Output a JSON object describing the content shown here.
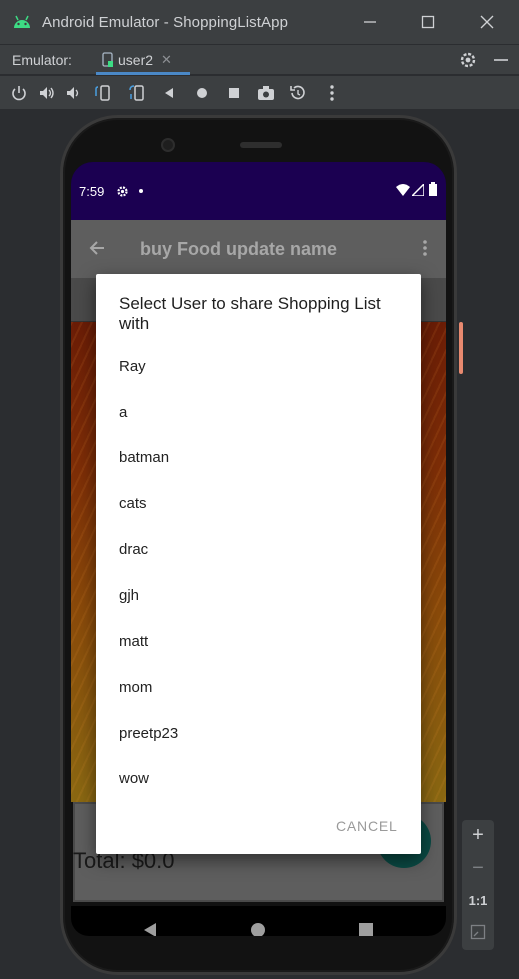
{
  "window": {
    "title": "Android Emulator - ShoppingListApp",
    "minimize_icon": "minimize-icon",
    "maximize_icon": "maximize-icon",
    "close_icon": "close-icon"
  },
  "tabbar": {
    "label": "Emulator:",
    "device_tab": "user2",
    "close_glyph": "✕"
  },
  "toolbar": {
    "icons": [
      "power-icon",
      "volume-up-icon",
      "volume-down-icon",
      "rotate-left-icon",
      "rotate-right-icon",
      "back-icon",
      "home-icon",
      "overview-icon",
      "screenshot-icon",
      "snapshot-icon",
      "more-icon"
    ]
  },
  "sidepanel": {
    "zoom_in": "+",
    "zoom_out": "−",
    "one_to_one": "1:1"
  },
  "device": {
    "status": {
      "time": "7:59"
    },
    "appbar": {
      "title": "buy Food update name"
    },
    "footer": {
      "total": "Total: $0.0"
    }
  },
  "dialog": {
    "title": "Select User to share Shopping List with",
    "users": [
      "Ray",
      "a",
      "batman",
      "cats",
      "drac",
      "gjh",
      "matt",
      "mom",
      "preetp23",
      "wow"
    ],
    "cancel": "CANCEL"
  },
  "colors": {
    "status_bar": "#1b0051",
    "accent_tab": "#4a88c7",
    "dialog_bg": "#ffffff"
  }
}
